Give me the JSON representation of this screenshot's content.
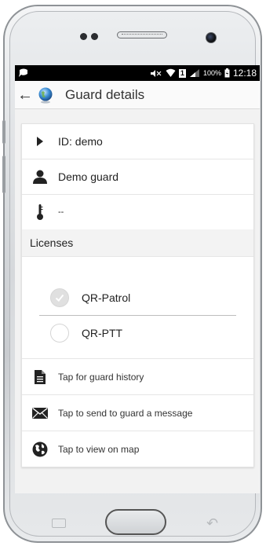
{
  "status": {
    "battery_percent": "100%",
    "sim_label": "1",
    "time": "12:18"
  },
  "appbar": {
    "title": "Guard details",
    "back_icon": "arrow-left-icon",
    "app_icon": "globe-icon"
  },
  "guard": {
    "id_text": "ID: demo",
    "name": "Demo guard",
    "temperature": "--"
  },
  "licenses": {
    "header": "Licenses",
    "items": [
      {
        "label": "QR-Patrol",
        "selected": true
      },
      {
        "label": "QR-PTT",
        "selected": false
      }
    ]
  },
  "actions": [
    {
      "label": "Tap for guard history",
      "icon": "document-icon"
    },
    {
      "label": "Tap to send to guard a message",
      "icon": "envelope-icon"
    },
    {
      "label": "Tap to view on map",
      "icon": "earth-icon"
    }
  ],
  "colors": {
    "status_bar": "#000000",
    "appbar_bg": "#fafafa",
    "content_bg": "#f2f2f2"
  }
}
